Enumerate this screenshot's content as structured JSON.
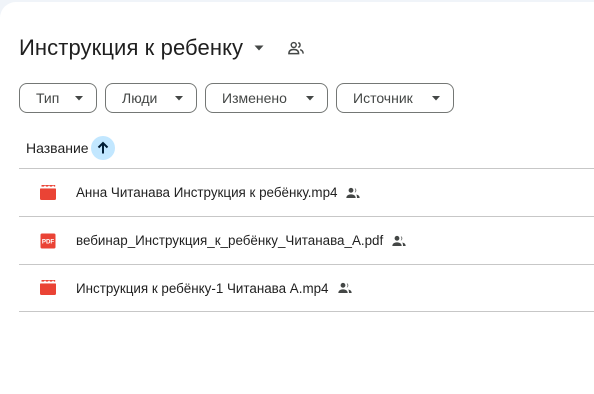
{
  "folder": {
    "title": "Инструкция к ребенку"
  },
  "filters": [
    {
      "label": "Тип"
    },
    {
      "label": "Люди"
    },
    {
      "label": "Изменено"
    },
    {
      "label": "Источник"
    }
  ],
  "list": {
    "column_name": "Название",
    "sort_direction": "ascending"
  },
  "files": [
    {
      "name": "Анна Читанава Инструкция к ребёнку.mp4",
      "icon": "video-file-icon",
      "shared": true
    },
    {
      "name": "вебинар_Инструкция_к_ребёнку_Читанава_А.pdf",
      "icon": "pdf-file-icon",
      "shared": true
    },
    {
      "name": "Инструкция к ребёнку-1 Читанава А.mp4",
      "icon": "video-file-icon",
      "shared": true
    }
  ],
  "colors": {
    "video_icon": "#ea4335",
    "pdf_icon": "#ea4335",
    "sort_highlight": "#c2e7ff",
    "divider": "#c7c7c7"
  }
}
